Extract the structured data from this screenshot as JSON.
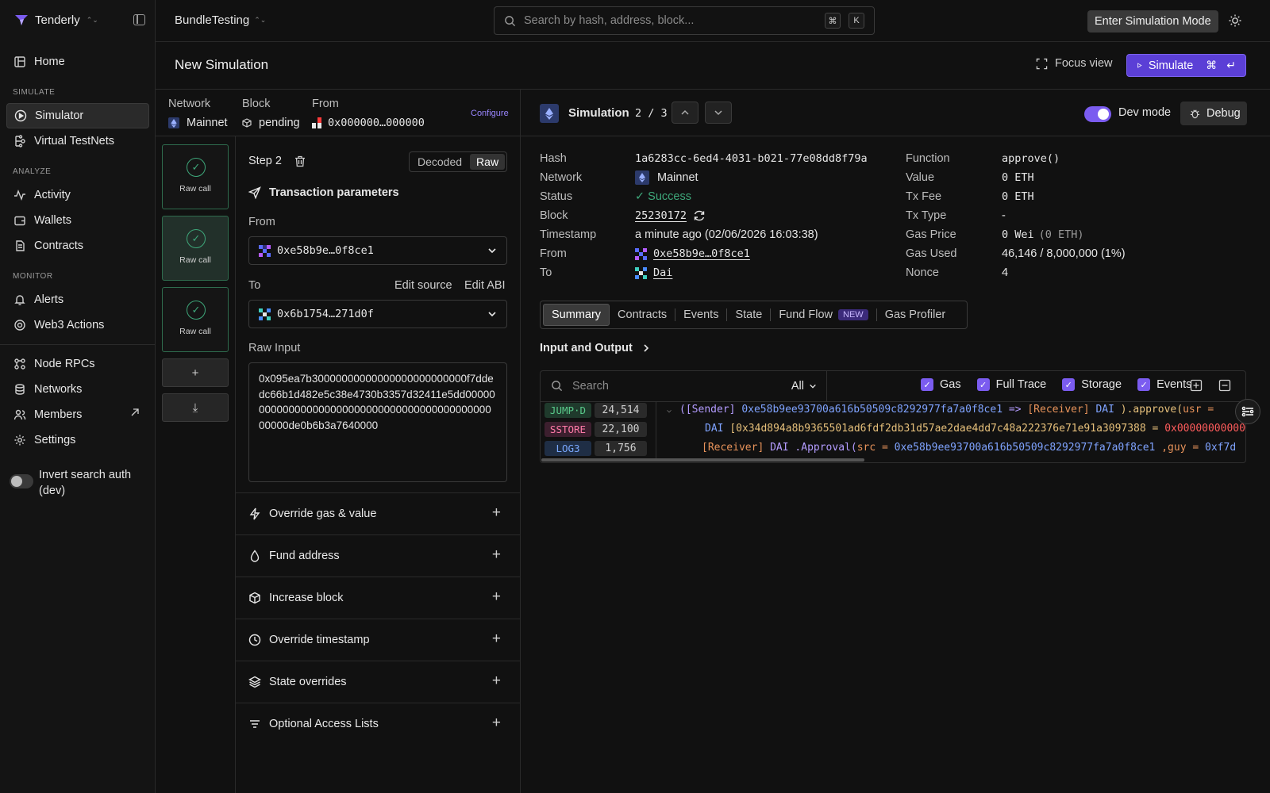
{
  "app": {
    "name": "Tenderly",
    "project": "BundleTesting"
  },
  "sidebar": {
    "home": "Home",
    "section_simulate": "SIMULATE",
    "simulator": "Simulator",
    "virtual_testnets": "Virtual TestNets",
    "section_analyze": "ANALYZE",
    "activity": "Activity",
    "wallets": "Wallets",
    "contracts": "Contracts",
    "section_monitor": "MONITOR",
    "alerts": "Alerts",
    "web3_actions": "Web3 Actions",
    "node_rpcs": "Node RPCs",
    "networks": "Networks",
    "members": "Members",
    "settings": "Settings",
    "invert_search_line1": "Invert search auth",
    "invert_search_line2": "(dev)"
  },
  "header": {
    "search_placeholder": "Search by hash, address, block...",
    "kbd_cmd": "⌘",
    "kbd_k": "K",
    "enter_sim_mode": "Enter Simulation Mode",
    "page_title": "New Simulation",
    "focus_view": "Focus view",
    "simulate": "Simulate"
  },
  "config": {
    "network_label": "Network",
    "network_value": "Mainnet",
    "block_label": "Block",
    "block_value": "pending",
    "from_label": "From",
    "from_value": "0x000000…000000",
    "configure": "Configure"
  },
  "steps": {
    "card_label": "Raw call",
    "add": "+",
    "download": "⤓"
  },
  "step_panel": {
    "title": "Step 2",
    "decoded": "Decoded",
    "raw": "Raw",
    "tx_params": "Transaction parameters",
    "from_label": "From",
    "from_value": "0xe58b9e…0f8ce1",
    "to_label": "To",
    "edit_source": "Edit source",
    "edit_abi": "Edit ABI",
    "to_value": "0x6b1754…271d0f",
    "raw_input_label": "Raw Input",
    "raw_input": "0x095ea7b30000000000000000000000000f7ddedc66b1d482e5c38e4730b3357d32411e5dd0000000000000000000000000000000000000000000000000de0b6b3a7640000",
    "sections": [
      "Override gas & value",
      "Fund address",
      "Increase block",
      "Override timestamp",
      "State overrides",
      "Optional Access Lists"
    ]
  },
  "simulation": {
    "title": "Simulation",
    "counter": "2 / 3",
    "dev_mode": "Dev mode",
    "debug": "Debug",
    "hash_label": "Hash",
    "hash": "1a6283cc-6ed4-4031-b021-77e08dd8f79a",
    "network_label": "Network",
    "network": "Mainnet",
    "status_label": "Status",
    "status": "Success",
    "block_label": "Block",
    "block": "25230172",
    "timestamp_label": "Timestamp",
    "timestamp": "a minute ago (02/06/2026 16:03:38)",
    "from_label": "From",
    "from": "0xe58b9e…0f8ce1",
    "to_label": "To",
    "to": "Dai",
    "function_label": "Function",
    "function": "approve()",
    "value_label": "Value",
    "value": "0 ETH",
    "tx_fee_label": "Tx Fee",
    "tx_fee": "0 ETH",
    "tx_type_label": "Tx Type",
    "tx_type": "-",
    "gas_price_label": "Gas Price",
    "gas_price": "0 Wei",
    "gas_price_eth": "(0 ETH)",
    "gas_used_label": "Gas Used",
    "gas_used": "46,146 / 8,000,000 (1%)",
    "nonce_label": "Nonce",
    "nonce": "4"
  },
  "tabs": [
    "Summary",
    "Contracts",
    "Events",
    "State",
    "Fund Flow",
    "Gas Profiler"
  ],
  "new_badge": "NEW",
  "io": {
    "title": "Input and Output",
    "search_placeholder": "Search",
    "filter": "All",
    "gas": "Gas",
    "full_trace": "Full Trace",
    "storage": "Storage",
    "events": "Events"
  },
  "trace": [
    {
      "op": "JUMP·D",
      "gas": "24,514"
    },
    {
      "op": "SSTORE",
      "gas": "22,100"
    },
    {
      "op": "LOG3",
      "gas": "1,756"
    }
  ],
  "trace_text": {
    "l1_sender": "([Sender]",
    "l1_addr": "0xe58b9ee93700a616b50509c8292977fa7a0f8ce1",
    "l1_arrow": "=>",
    "l1_receiver": "[Receiver]",
    "l1_dai": "DAI",
    "l1_call": ").approve(",
    "l1_usr": "usr =",
    "l2_dai": "DAI",
    "l2_slot": "0x34d894a8b9365501ad6fdf2db31d57ae2dae4dd7c48a222376e71e91a3097388",
    "l2_eq": "=",
    "l2_val": "0x000000000000",
    "l3_receiver": "[Receiver]",
    "l3_event": "DAI .Approval(",
    "l3_src": "src =",
    "l3_addr": "0xe58b9ee93700a616b50509c8292977fa7a0f8ce1",
    "l3_guy": ",guy =",
    "l3_guy_val": "0xf7d"
  },
  "colors": {
    "accent": "#7b5cf0",
    "success": "#3ea77a",
    "simulate_button": "#5b3fd6"
  }
}
